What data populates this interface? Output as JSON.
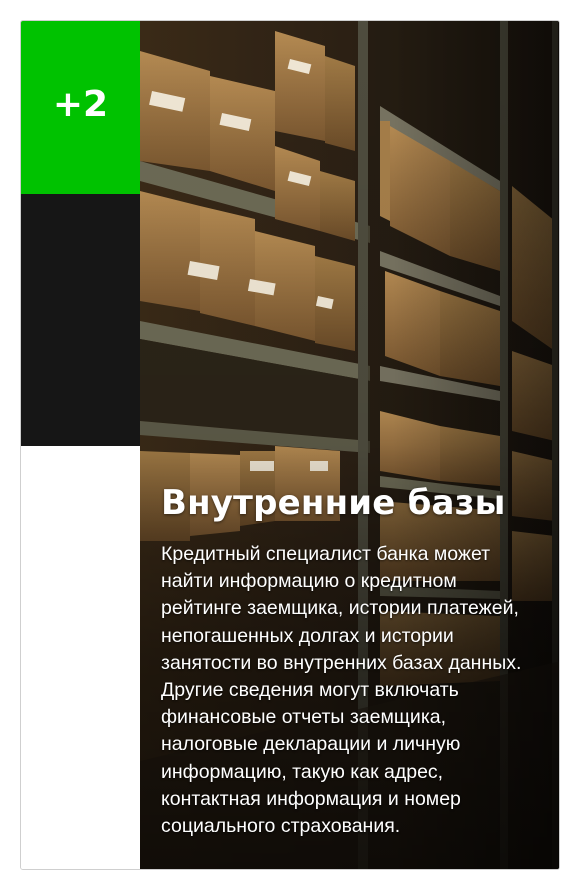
{
  "card": {
    "badge": "+2",
    "title": "Внутренние базы",
    "description": "Кредитный специалист банка может\nнайти информацию о кредитном\nрейтинге заемщика, истории платежей,\nнепогашенных долгах и истории\nзанятости во внутренних базах данных.\nДругие сведения могут включать\nфинансовые отчеты заемщика,\nналоговые декларации и личную\nинформацию, такую как адрес,\nконтактная информация и номер\nсоциального страхования.",
    "accent_color": "#00c200",
    "image_subject": "archive-shelves-with-file-folders"
  }
}
